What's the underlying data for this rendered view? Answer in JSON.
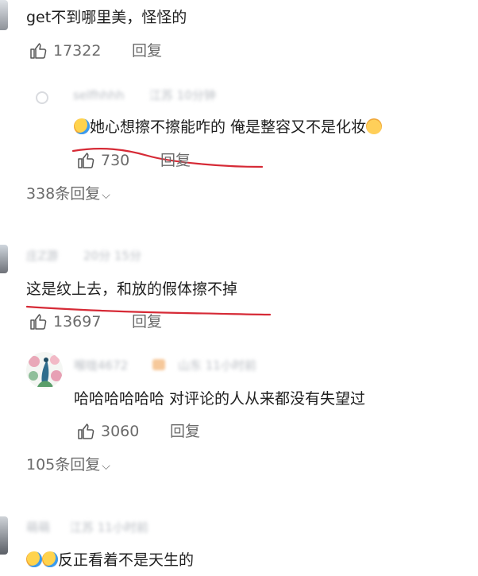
{
  "colors": {
    "text": "#1e1e1e",
    "meta": "#6b6b6b",
    "underline": "#d62a36",
    "blur": "#b8bcc2"
  },
  "comments": [
    {
      "text": "get不到哪里美，怪怪的",
      "likes": "17322",
      "reply_label": "回复",
      "replies": [
        {
          "user": "selfhhhh",
          "meta": "江苏 10分钟",
          "emoji_lead": "crying-laughing-emoji",
          "text": "她心想擦不擦能咋的 俺是整容又不是化妆",
          "emoji_trail": "grinning-cat-emoji",
          "likes": "730",
          "reply_label": "回复"
        }
      ],
      "more_replies": "338条回复"
    },
    {
      "user": "庄Z游",
      "meta": "20分 15分",
      "text": "这是纹上去，和放的假体擦不掉",
      "likes": "13697",
      "reply_label": "回复",
      "replies": [
        {
          "user": "喉咙4672",
          "meta": "山东 11小时前",
          "text": "哈哈哈哈哈哈 对评论的人从来都没有失望过",
          "likes": "3060",
          "reply_label": "回复"
        }
      ],
      "more_replies": "105条回复"
    },
    {
      "user": "萌萌",
      "meta": "江苏 11小时前",
      "text": "反正看着不是天生的"
    }
  ]
}
